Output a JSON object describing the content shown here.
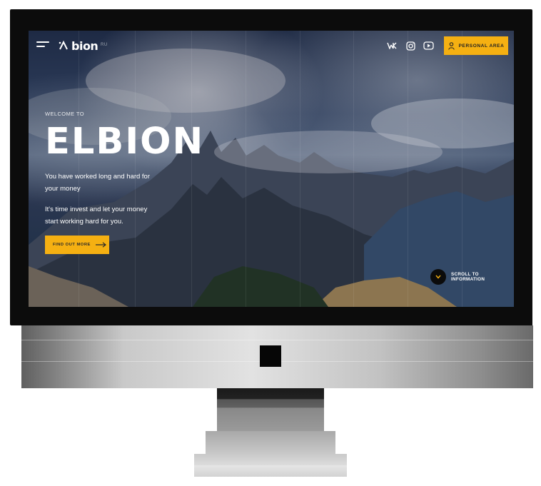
{
  "site": {
    "logo_text": "bion",
    "language": "RU"
  },
  "header": {
    "social_icons": [
      "vk-icon",
      "instagram-icon",
      "youtube-icon"
    ],
    "personal_area_label": "PERSONAL AREA",
    "personal_icon": "user-icon"
  },
  "hero": {
    "welcome": "WELCOME TO",
    "title": "ELBION",
    "desc1": "You have worked long and hard for your money",
    "desc2": "It's time invest and let your money start working hard for you.",
    "cta_label": "FIND OUT MORE",
    "cta_icon": "arrow-right-icon"
  },
  "scroll": {
    "label": "SCROLL TO INFORMATION",
    "icon": "chevron-down-icon"
  },
  "colors": {
    "accent": "#f5b012",
    "bezel": "#0c0c0c",
    "text_on_dark": "#ffffff"
  }
}
